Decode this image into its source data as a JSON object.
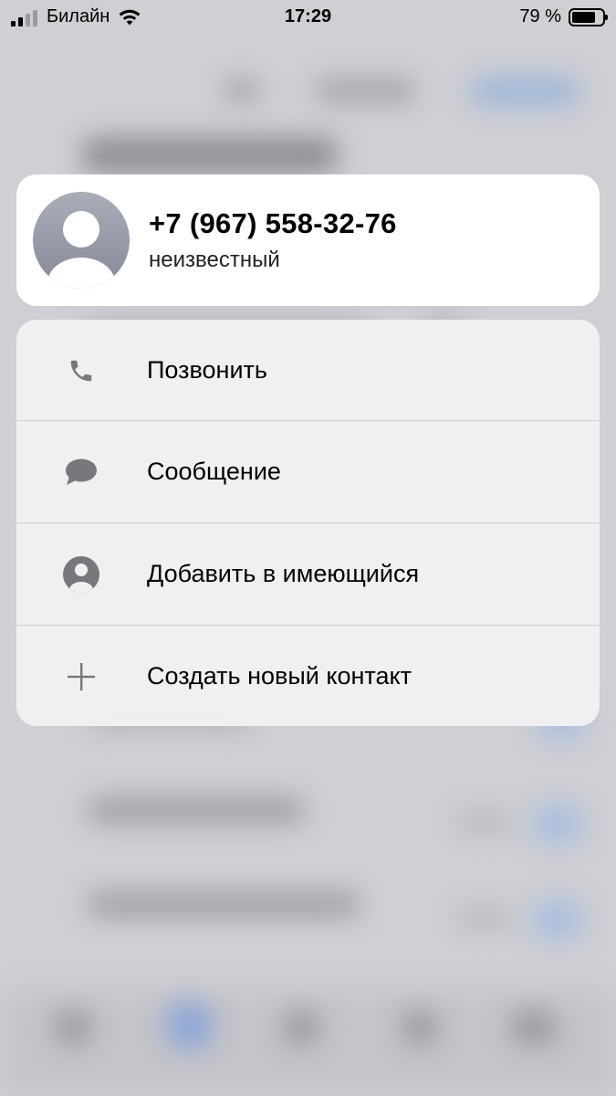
{
  "status_bar": {
    "carrier": "Билайн",
    "time": "17:29",
    "battery_percent_label": "79 %",
    "battery_level": 0.79,
    "signal_bars_active": 2,
    "signal_bars_total": 4
  },
  "contact": {
    "phone": "+7 (967) 558-32-76",
    "status": "неизвестный"
  },
  "menu": {
    "items": [
      {
        "label": "Позвонить",
        "icon": "phone-icon"
      },
      {
        "label": "Сообщение",
        "icon": "message-bubble-icon"
      },
      {
        "label": "Добавить в имеющийся",
        "icon": "person-circle-icon"
      },
      {
        "label": "Создать новый контакт",
        "icon": "plus-icon"
      }
    ]
  },
  "colors": {
    "icon": "#77777c",
    "avatar_top": "#a9adb8",
    "avatar_bottom": "#858a97",
    "background": "#cfcfd4"
  }
}
